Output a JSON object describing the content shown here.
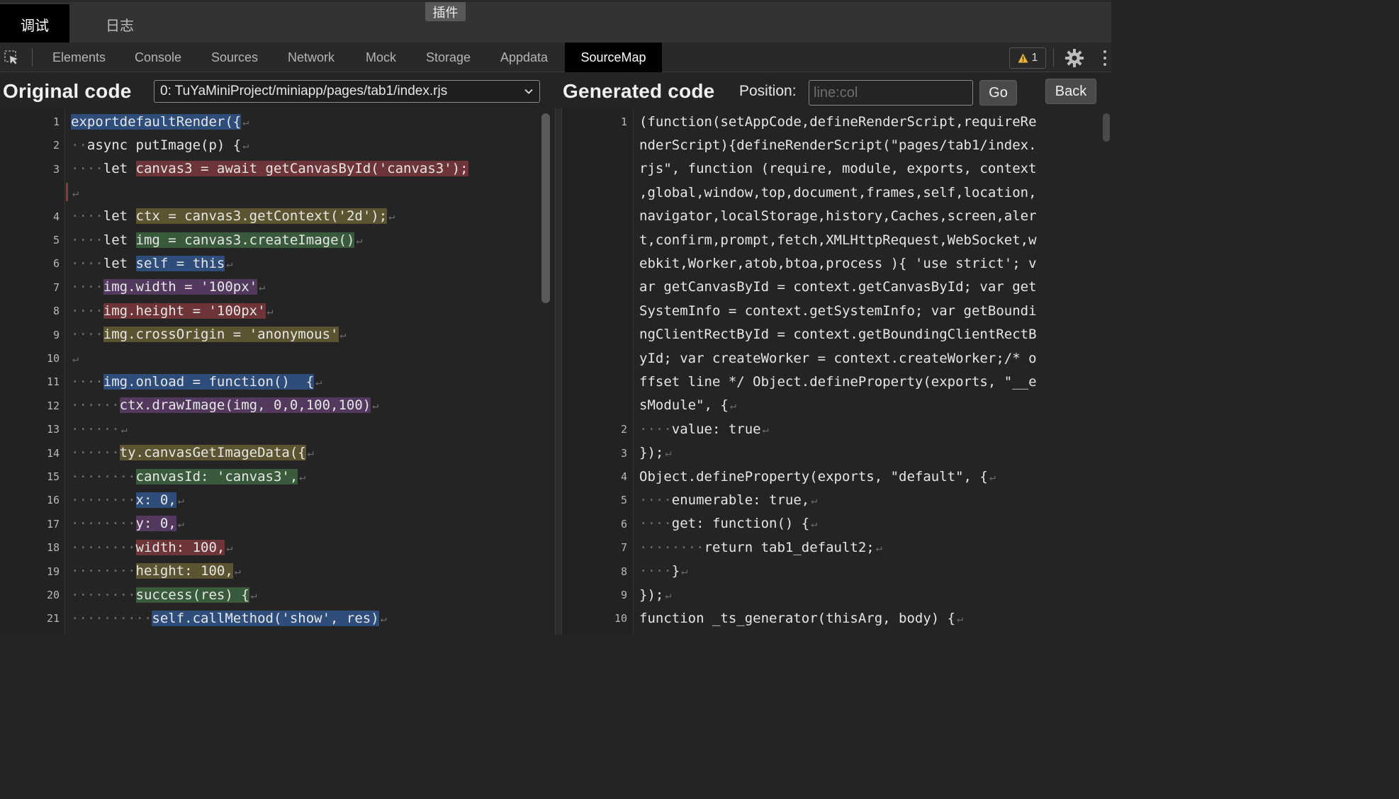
{
  "top_tabs": {
    "debug": "调试",
    "log": "日志",
    "plugin": "插件"
  },
  "devtools": {
    "tabs": [
      "Elements",
      "Console",
      "Sources",
      "Network",
      "Mock",
      "Storage",
      "Appdata",
      "SourceMap"
    ],
    "active_tab": "SourceMap",
    "warning_count": "1",
    "icons": [
      "inspect-cursor-icon",
      "warning-triangle-icon",
      "gear-icon",
      "kebab-menu-icon"
    ]
  },
  "original": {
    "title": "Original code",
    "file": "0: TuYaMiniProject/miniapp/pages/tab1/index.rjs",
    "lines": [
      {
        "n": "1",
        "text": "export default Render({"
      },
      {
        "n": "2",
        "text": "··async putImage(p) {"
      },
      {
        "n": "3",
        "text": "····let canvas3 = await getCanvasById('canvas3');"
      },
      {
        "n": "",
        "text": ""
      },
      {
        "n": "4",
        "text": "····let ctx = canvas3.getContext('2d');"
      },
      {
        "n": "5",
        "text": "····let img = canvas3.createImage()"
      },
      {
        "n": "6",
        "text": "····let self = this"
      },
      {
        "n": "7",
        "text": "····img.width = '100px'"
      },
      {
        "n": "8",
        "text": "····img.height = '100px'"
      },
      {
        "n": "9",
        "text": "····img.crossOrigin = 'anonymous'"
      },
      {
        "n": "10",
        "text": ""
      },
      {
        "n": "11",
        "text": "····img.onload = function()  {"
      },
      {
        "n": "12",
        "text": "······ctx.drawImage(img, 0,0,100,100)"
      },
      {
        "n": "13",
        "text": "······"
      },
      {
        "n": "14",
        "text": "······ty.canvasGetImageData({"
      },
      {
        "n": "15",
        "text": "········canvasId: 'canvas3',"
      },
      {
        "n": "16",
        "text": "········x: 0,"
      },
      {
        "n": "17",
        "text": "········y: 0,"
      },
      {
        "n": "18",
        "text": "········width: 100,"
      },
      {
        "n": "19",
        "text": "········height: 100,"
      },
      {
        "n": "20",
        "text": "········success(res) {"
      },
      {
        "n": "21",
        "text": "··········self.callMethod('show', res)"
      }
    ]
  },
  "generated": {
    "title": "Generated code",
    "position_label": "Position:",
    "position_placeholder": "line:col",
    "go_label": "Go",
    "back_label": "Back",
    "lines": [
      {
        "n": "1",
        "text": "(function(setAppCode,defineRenderScript,requireRe"
      },
      {
        "n": "",
        "text": "nderScript){defineRenderScript(\"pages/tab1/index."
      },
      {
        "n": "",
        "text": "rjs\", function (require, module, exports, context"
      },
      {
        "n": "",
        "text": ",global,window,top,document,frames,self,location,"
      },
      {
        "n": "",
        "text": "navigator,localStorage,history,Caches,screen,aler"
      },
      {
        "n": "",
        "text": "t,confirm,prompt,fetch,XMLHttpRequest,WebSocket,w"
      },
      {
        "n": "",
        "text": "ebkit,Worker,atob,btoa,process ){ 'use strict'; v"
      },
      {
        "n": "",
        "text": "ar getCanvasById = context.getCanvasById; var get"
      },
      {
        "n": "",
        "text": "SystemInfo = context.getSystemInfo; var getBoundi"
      },
      {
        "n": "",
        "text": "ngClientRectById = context.getBoundingClientRectB"
      },
      {
        "n": "",
        "text": "yId; var createWorker = context.createWorker;/* o"
      },
      {
        "n": "",
        "text": "ffset line */ Object.defineProperty(exports, \"__e"
      },
      {
        "n": "",
        "text": "sModule\", {"
      },
      {
        "n": "2",
        "text": "····value: true"
      },
      {
        "n": "3",
        "text": "});"
      },
      {
        "n": "4",
        "text": "Object.defineProperty(exports, \"default\", {"
      },
      {
        "n": "5",
        "text": "····enumerable: true,"
      },
      {
        "n": "6",
        "text": "····get: function() {"
      },
      {
        "n": "7",
        "text": "········return tab1_default2;"
      },
      {
        "n": "8",
        "text": "····}"
      },
      {
        "n": "9",
        "text": "});"
      },
      {
        "n": "10",
        "text": "function _ts_generator(thisArg, body) {"
      }
    ]
  },
  "colors": {
    "blue": "#2f4d7a",
    "red": "#6e3538",
    "gold": "#5c5430",
    "green": "#3a5a3c",
    "purple": "#54395e"
  }
}
